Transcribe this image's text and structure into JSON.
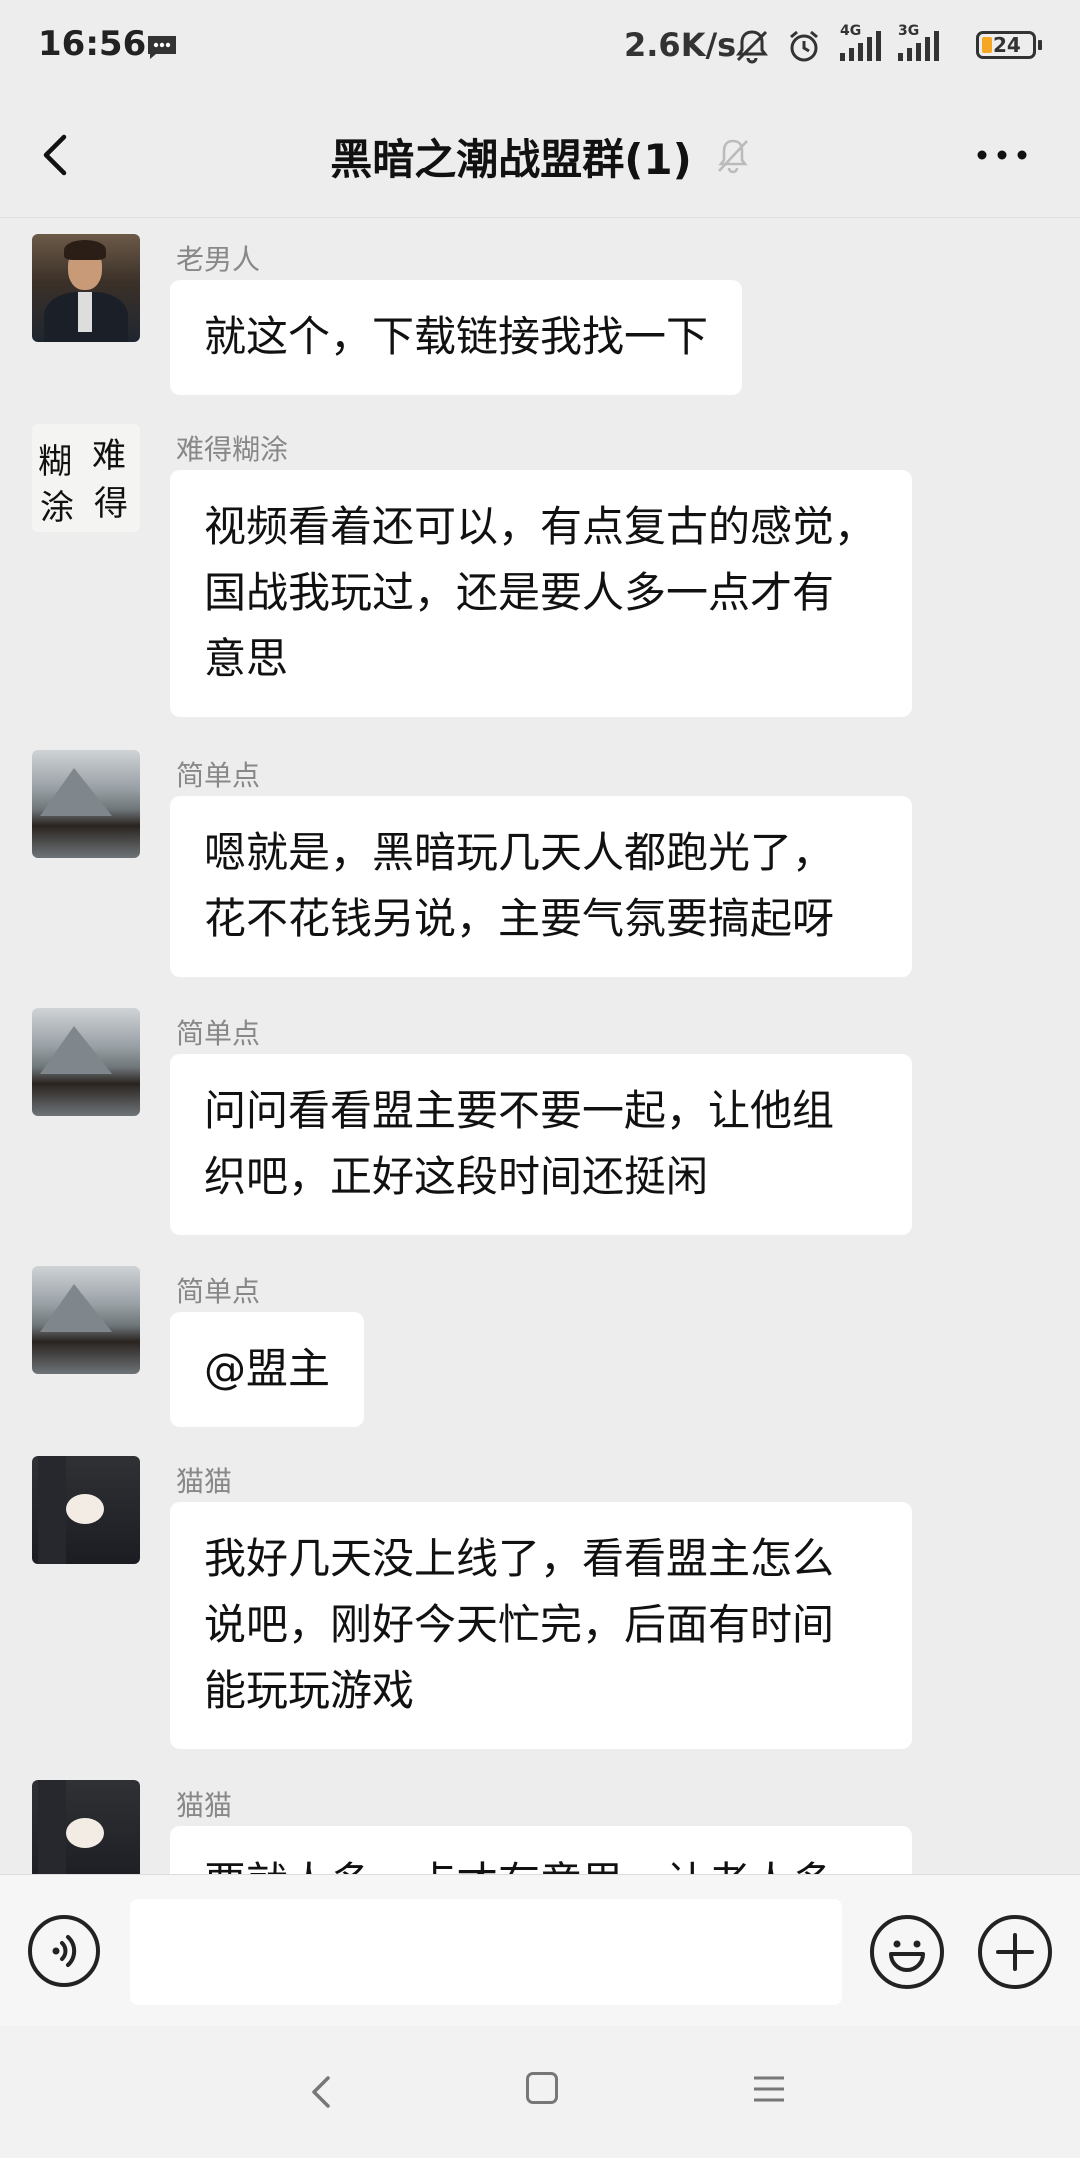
{
  "status_bar": {
    "time": "16:56",
    "net_speed": "2.6K/s",
    "signal_1_label": "4G",
    "signal_2_label": "3G",
    "battery": "24"
  },
  "header": {
    "title": "黑暗之潮战盟群(1)"
  },
  "messages": [
    {
      "sender": "老男人",
      "text": "就这个，下载链接我找一下"
    },
    {
      "sender": "难得糊涂",
      "text": "视频看着还可以，有点复古的感觉，\n国战我玩过，还是要人多一点才有\n意思"
    },
    {
      "sender": "简单点",
      "text": "嗯就是，黑暗玩几天人都跑光了，\n花不花钱另说，主要气氛要搞起呀"
    },
    {
      "sender": "简单点",
      "text": "问问看看盟主要不要一起，让他组\n织吧，正好这段时间还挺闲"
    },
    {
      "sender": "简单点",
      "text": "@盟主"
    },
    {
      "sender": "猫猫",
      "text": "我好几天没上线了，看看盟主怎么\n说吧，刚好今天忙完，后面有时间\n能玩玩游戏"
    },
    {
      "sender": "猫猫",
      "text": "要就人多一点才有意思，让老人多"
    }
  ],
  "avatar_calligraphy": [
    "糊",
    "涂",
    "难",
    "得"
  ],
  "input": {
    "value": "",
    "placeholder": ""
  }
}
